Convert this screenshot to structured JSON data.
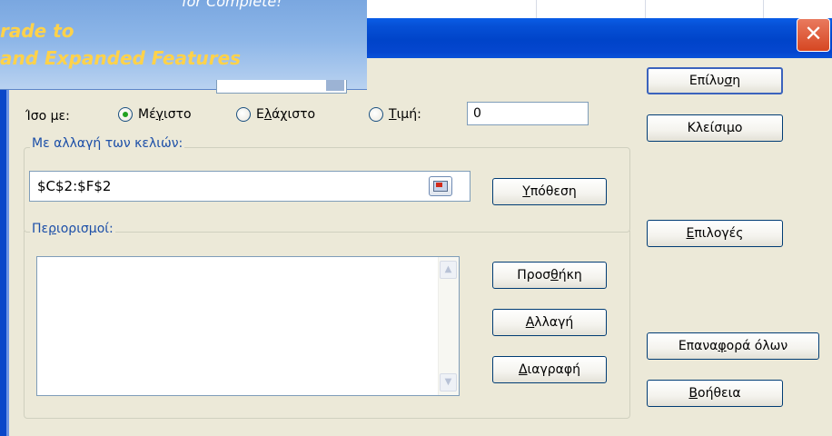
{
  "promo": {
    "top_text": "for Complete!",
    "line1": "rade to",
    "line2": "and Expanded Features"
  },
  "dialog": {
    "close_glyph": "✕"
  },
  "equal_to": {
    "label": "Ίσο με:",
    "options": [
      {
        "pre": "Μέ",
        "ul": "γ",
        "post": "ιστο",
        "checked": true
      },
      {
        "pre": "Ε",
        "ul": "λ",
        "post": "άχιστο",
        "checked": false
      },
      {
        "pre": "",
        "ul": "Τ",
        "post": "ιμή:",
        "checked": false
      }
    ],
    "value": "0"
  },
  "changing_cells": {
    "legend": "Με αλλαγή των κελιών:",
    "value": "$C$2:$F$2"
  },
  "constraints": {
    "legend_pre": "Πε",
    "legend_ul": "ρ",
    "legend_post": "ιορισμοί:",
    "items": []
  },
  "buttons": {
    "solve": {
      "pre": "Επίλυ",
      "ul": "σ",
      "post": "η"
    },
    "close": {
      "pre": "",
      "ul": "",
      "post": "Κλείσιμο"
    },
    "guess": {
      "pre": "",
      "ul": "Υ",
      "post": "πόθεση"
    },
    "options": {
      "pre": "",
      "ul": "Ε",
      "post": "πιλογές"
    },
    "add": {
      "pre": "Προσ",
      "ul": "θ",
      "post": "ήκη"
    },
    "change": {
      "pre": "",
      "ul": "Α",
      "post": "λλαγή"
    },
    "delete": {
      "pre": "",
      "ul": "Δ",
      "post": "ιαγραφή"
    },
    "reset_all": {
      "pre": "Επανα",
      "ul": "φ",
      "post": "ορά όλων"
    },
    "help": {
      "pre": "",
      "ul": "Β",
      "post": "οήθεια"
    }
  }
}
